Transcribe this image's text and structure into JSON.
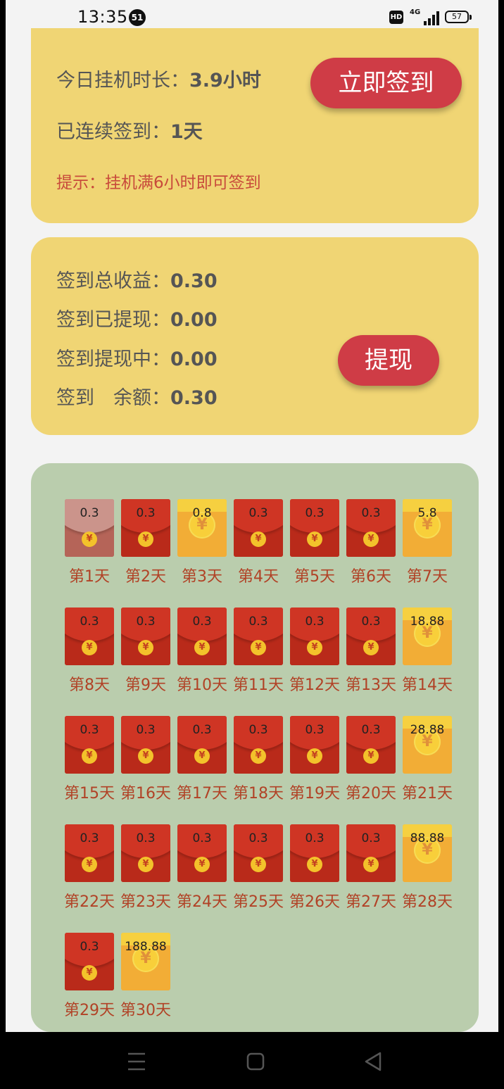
{
  "status_bar": {
    "time": "13:35",
    "notification_count": "51",
    "hd": "HD",
    "network": "4G",
    "battery": "57"
  },
  "checkin": {
    "today_label": "今日挂机时长：",
    "today_value": "3.9小时",
    "streak_label": "已连续签到：",
    "streak_value": "1天",
    "hint": "提示：挂机满6小时即可签到",
    "button": "立即签到"
  },
  "earnings": {
    "total_label": "签到总收益：",
    "total_value": "0.30",
    "withdrawn_label": "签到已提现：",
    "withdrawn_value": "0.00",
    "pending_label": "签到提现中：",
    "pending_value": "0.00",
    "balance_label": "签到　余额：",
    "balance_value": "0.30",
    "button": "提现"
  },
  "calendar": {
    "coin_symbol": "¥",
    "days": [
      {
        "label": "第1天",
        "amount": "0.3",
        "style": "claimed"
      },
      {
        "label": "第2天",
        "amount": "0.3",
        "style": "red"
      },
      {
        "label": "第3天",
        "amount": "0.8",
        "style": "gold"
      },
      {
        "label": "第4天",
        "amount": "0.3",
        "style": "red"
      },
      {
        "label": "第5天",
        "amount": "0.3",
        "style": "red"
      },
      {
        "label": "第6天",
        "amount": "0.3",
        "style": "red"
      },
      {
        "label": "第7天",
        "amount": "5.8",
        "style": "gold"
      },
      {
        "label": "第8天",
        "amount": "0.3",
        "style": "red"
      },
      {
        "label": "第9天",
        "amount": "0.3",
        "style": "red"
      },
      {
        "label": "第10天",
        "amount": "0.3",
        "style": "red"
      },
      {
        "label": "第11天",
        "amount": "0.3",
        "style": "red"
      },
      {
        "label": "第12天",
        "amount": "0.3",
        "style": "red"
      },
      {
        "label": "第13天",
        "amount": "0.3",
        "style": "red"
      },
      {
        "label": "第14天",
        "amount": "18.88",
        "style": "gold"
      },
      {
        "label": "第15天",
        "amount": "0.3",
        "style": "red"
      },
      {
        "label": "第16天",
        "amount": "0.3",
        "style": "red"
      },
      {
        "label": "第17天",
        "amount": "0.3",
        "style": "red"
      },
      {
        "label": "第18天",
        "amount": "0.3",
        "style": "red"
      },
      {
        "label": "第19天",
        "amount": "0.3",
        "style": "red"
      },
      {
        "label": "第20天",
        "amount": "0.3",
        "style": "red"
      },
      {
        "label": "第21天",
        "amount": "28.88",
        "style": "gold"
      },
      {
        "label": "第22天",
        "amount": "0.3",
        "style": "red"
      },
      {
        "label": "第23天",
        "amount": "0.3",
        "style": "red"
      },
      {
        "label": "第24天",
        "amount": "0.3",
        "style": "red"
      },
      {
        "label": "第25天",
        "amount": "0.3",
        "style": "red"
      },
      {
        "label": "第26天",
        "amount": "0.3",
        "style": "red"
      },
      {
        "label": "第27天",
        "amount": "0.3",
        "style": "red"
      },
      {
        "label": "第28天",
        "amount": "88.88",
        "style": "gold"
      },
      {
        "label": "第29天",
        "amount": "0.3",
        "style": "red"
      },
      {
        "label": "第30天",
        "amount": "188.88",
        "style": "gold"
      }
    ]
  }
}
